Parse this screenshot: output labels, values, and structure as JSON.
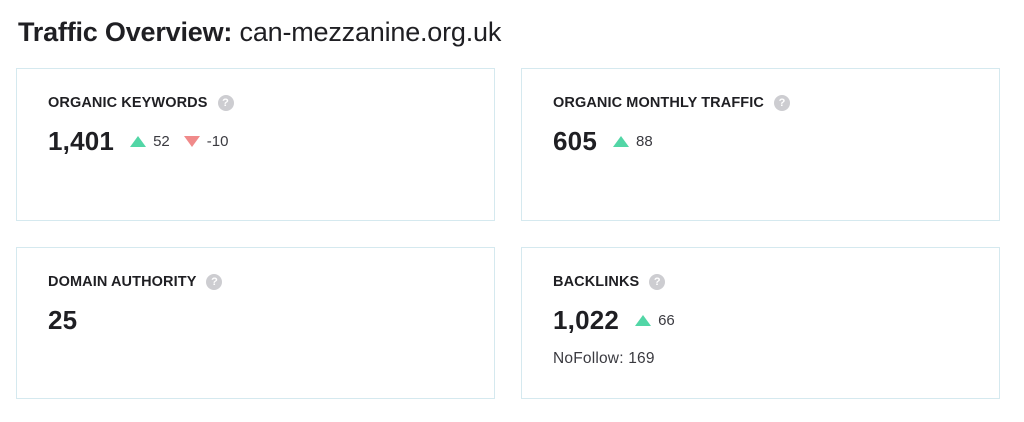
{
  "header": {
    "title_lead": "Traffic Overview:",
    "domain": "can-mezzanine.org.uk"
  },
  "colors": {
    "card_border": "#d5e9ef",
    "delta_up": "#52d6a6",
    "delta_down": "#f08a8a",
    "help_icon": "#cdcdd1"
  },
  "cards": {
    "organic_keywords": {
      "label": "ORGANIC KEYWORDS",
      "help_glyph": "?",
      "value": "1,401",
      "delta_up": "52",
      "delta_down": "-10"
    },
    "organic_monthly_traffic": {
      "label": "ORGANIC MONTHLY TRAFFIC",
      "help_glyph": "?",
      "value": "605",
      "delta_up": "88"
    },
    "domain_authority": {
      "label": "DOMAIN AUTHORITY",
      "help_glyph": "?",
      "value": "25"
    },
    "backlinks": {
      "label": "BACKLINKS",
      "help_glyph": "?",
      "value": "1,022",
      "delta_up": "66",
      "nofollow_label": "NoFollow:",
      "nofollow_value": "169"
    }
  }
}
